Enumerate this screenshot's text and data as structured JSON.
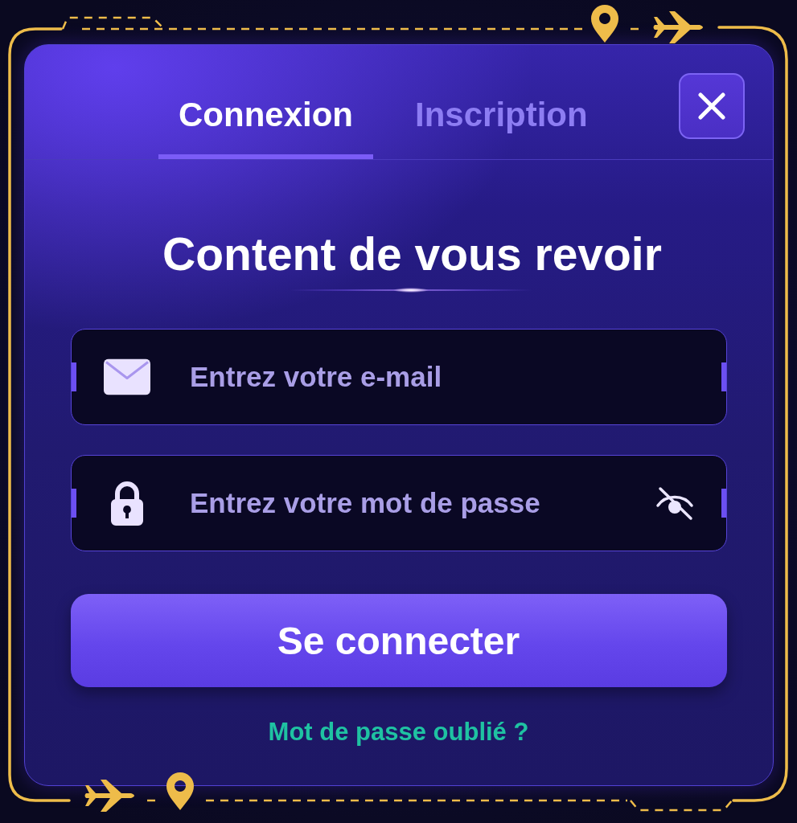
{
  "dialog": {
    "tabs": [
      {
        "label": "Connexion",
        "selected": true
      },
      {
        "label": "Inscription",
        "selected": false
      }
    ],
    "title": "Content de vous revoir",
    "fields": [
      {
        "kind": "email",
        "placeholder": "Entrez votre e-mail"
      },
      {
        "kind": "password",
        "placeholder": "Entrez votre mot de passe",
        "show_password": false
      }
    ],
    "submit_button": "Se connecter",
    "forgot_password_link": "Mot de passe oublié ?"
  }
}
